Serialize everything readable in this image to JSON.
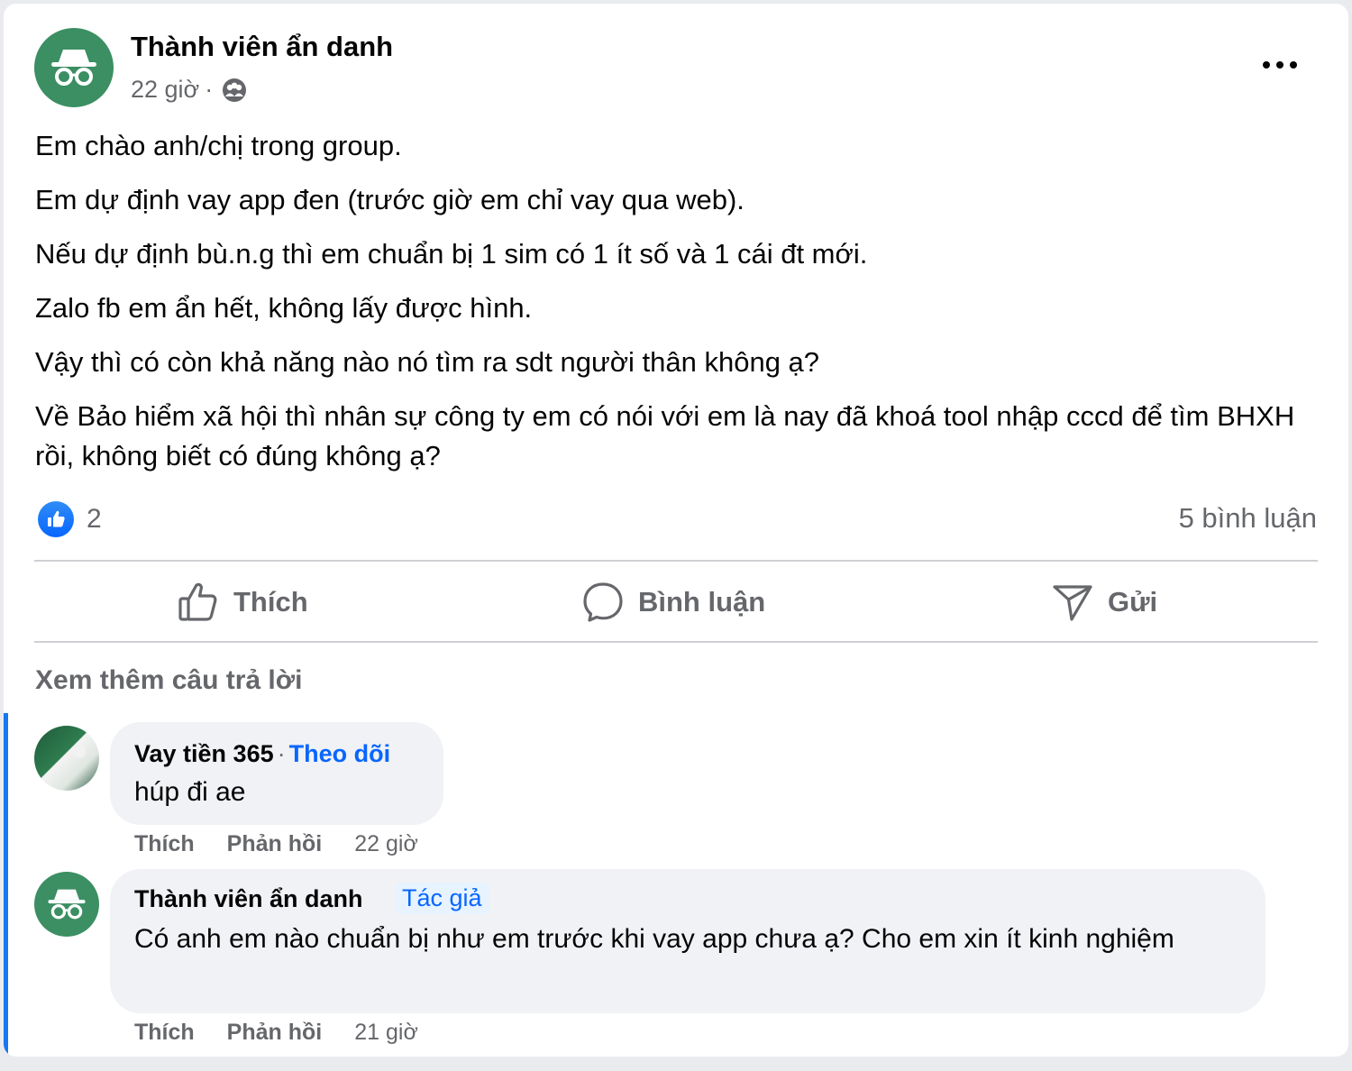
{
  "post": {
    "author": "Thành viên ẩn danh",
    "time": "22 giờ",
    "separator": "·",
    "lines": [
      "Em chào anh/chị trong group.",
      "Em dự định vay app đen (trước giờ em chỉ vay qua web).",
      "Nếu dự định bù.n.g thì em chuẩn bị 1 sim có 1 ít số và 1 cái đt mới.",
      "Zalo fb em ẩn hết, không lấy được hình.",
      "Vậy thì có còn khả năng nào nó tìm ra sdt người thân không ạ?",
      "Về Bảo hiểm xã hội thì nhân sự công ty em có nói với em là nay đã khoá tool nhập cccd để tìm BHXH rồi, không biết có đúng không ạ?"
    ],
    "reaction_count": "2",
    "comment_count": "5 bình luận"
  },
  "actions": {
    "like": "Thích",
    "comment": "Bình luận",
    "send": "Gửi"
  },
  "more_replies": "Xem thêm câu trả lời",
  "comments": [
    {
      "name": "Vay tiền 365",
      "separator": "·",
      "follow": "Theo dõi",
      "text": "húp đi ae",
      "like": "Thích",
      "reply": "Phản hồi",
      "time": "22 giờ"
    },
    {
      "name": "Thành viên ẩn danh",
      "badge": "Tác giả",
      "text": "Có anh em nào chuẩn bị như em trước khi vay app chưa ạ? Cho em xin ít kinh nghiệm",
      "like": "Thích",
      "reply": "Phản hồi",
      "time": "21 giờ"
    }
  ],
  "icons": {
    "anonymous_avatar": "incognito-icon",
    "audience": "group-icon",
    "more": "more-icon",
    "reaction": "like-reaction-icon",
    "like_action": "thumbs-up-icon",
    "comment_action": "comment-bubble-icon",
    "send_action": "send-icon"
  },
  "colors": {
    "accent": "#0866ff",
    "anonymous_avatar": "#3b8f62",
    "secondary_text": "#65676b",
    "bubble": "#f0f2f5"
  }
}
